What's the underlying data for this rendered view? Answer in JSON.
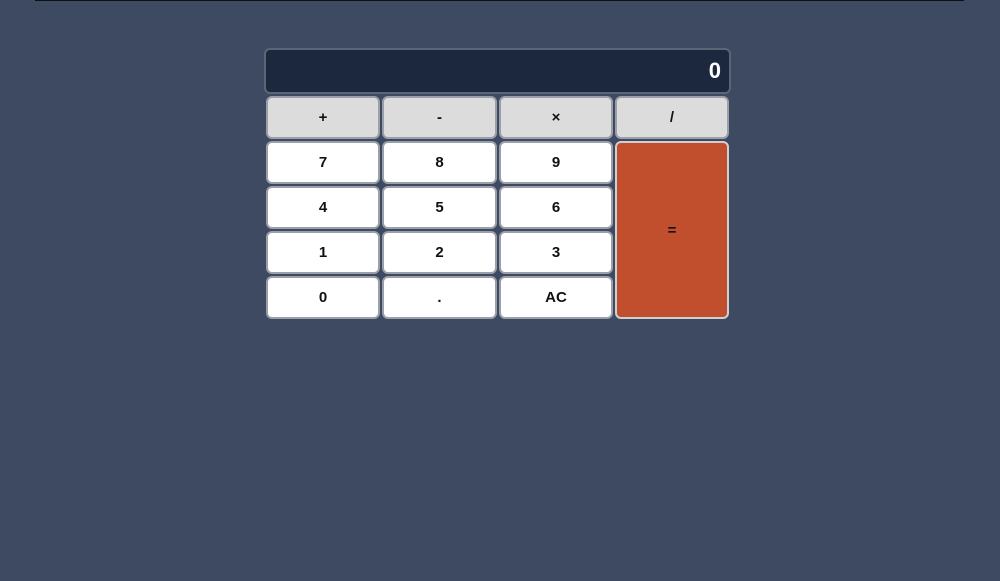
{
  "calculator": {
    "display_value": "0",
    "operators": {
      "add": "+",
      "subtract": "-",
      "multiply": "×",
      "divide": "/"
    },
    "keys": {
      "seven": "7",
      "eight": "8",
      "nine": "9",
      "four": "4",
      "five": "5",
      "six": "6",
      "one": "1",
      "two": "2",
      "three": "3",
      "zero": "0",
      "decimal": ".",
      "clear": "AC",
      "equals": "="
    }
  },
  "colors": {
    "background": "#3e4a62",
    "display": "#1c283d",
    "operator_key": "#dcdcdc",
    "number_key": "#ffffff",
    "equals_key": "#c14e2d"
  }
}
